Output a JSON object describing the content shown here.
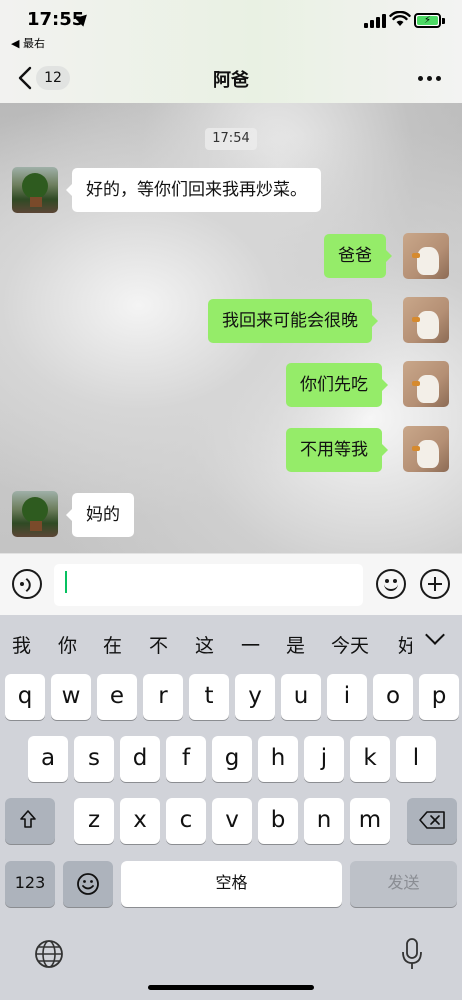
{
  "status_bar": {
    "time": "17:55",
    "back_app": "◀ 最右"
  },
  "nav": {
    "unread_count": "12",
    "title": "阿爸"
  },
  "chat": {
    "timestamp": "17:54",
    "messages": [
      {
        "side": "in",
        "text": "好的，等你们回来我再炒菜。"
      },
      {
        "side": "out",
        "text": "爸爸"
      },
      {
        "side": "out",
        "text": "我回来可能会很晚"
      },
      {
        "side": "out",
        "text": "你们先吃"
      },
      {
        "side": "out",
        "text": "不用等我"
      },
      {
        "side": "in",
        "text": "妈的"
      }
    ]
  },
  "input": {
    "value": ""
  },
  "candidates": [
    "我",
    "你",
    "在",
    "不",
    "这",
    "一",
    "是",
    "今天",
    "好"
  ],
  "keyboard": {
    "row1": [
      "q",
      "w",
      "e",
      "r",
      "t",
      "y",
      "u",
      "i",
      "o",
      "p"
    ],
    "row2": [
      "a",
      "s",
      "d",
      "f",
      "g",
      "h",
      "j",
      "k",
      "l"
    ],
    "row3": [
      "z",
      "x",
      "c",
      "v",
      "b",
      "n",
      "m"
    ],
    "numbers_label": "123",
    "space_label": "空格",
    "send_label": "发送"
  },
  "colors": {
    "outgoing_bubble": "#95ec69",
    "incoming_bubble": "#ffffff",
    "caret": "#07c160"
  },
  "icons": [
    "location-arrow-icon",
    "signal-icon",
    "wifi-icon",
    "battery-charging-icon",
    "back-chevron-icon",
    "more-dots-icon",
    "voice-icon",
    "emoji-icon",
    "plus-icon",
    "chevron-down-icon",
    "shift-icon",
    "delete-icon",
    "emoji-key-icon",
    "globe-icon",
    "mic-icon"
  ]
}
